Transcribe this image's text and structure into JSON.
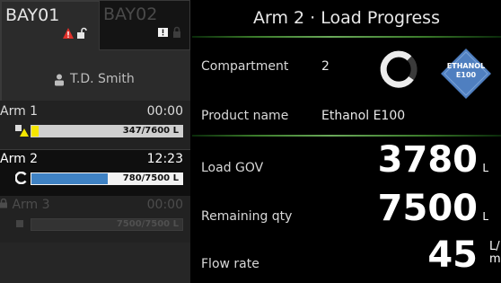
{
  "bays": [
    {
      "label": "BAY01",
      "state": "active"
    },
    {
      "label": "BAY02",
      "state": "inactive"
    }
  ],
  "operator": {
    "name": "T.D. Smith"
  },
  "arms": [
    {
      "name": "Arm 1",
      "time": "00:00",
      "bar_text": "347/7600 L",
      "loaded": 347,
      "preset": 7600
    },
    {
      "name": "Arm 2",
      "time": "12:23",
      "bar_text": "780/7500 L",
      "loaded": 3780,
      "preset": 7500
    },
    {
      "name": "Arm 3",
      "time": "00:00",
      "bar_text": "7500/7500 L",
      "loaded": 0,
      "preset": 7500
    }
  ],
  "detail": {
    "title": "Arm 2 · Load Progress",
    "compartment_label": "Compartment",
    "compartment_value": "2",
    "product_label": "Product name",
    "product_value": "Ethanol E100",
    "product_badge": [
      "ETHANOL",
      "E100"
    ],
    "load_gov_label": "Load GOV",
    "load_gov_value": "3780",
    "load_gov_unit": "L",
    "remaining_label": "Remaining qty",
    "remaining_value": "7500",
    "remaining_unit": "L",
    "flow_label": "Flow rate",
    "flow_value": "45",
    "flow_unit_top": "L/",
    "flow_unit_bottom": "mi"
  },
  "colors": {
    "alarm_red": "#e0302a",
    "arm1_bar": "#f5e600",
    "arm2_bar": "#3f82c4",
    "badge_blue": "#4f7fc0",
    "accent_green": "#6aa85a"
  }
}
